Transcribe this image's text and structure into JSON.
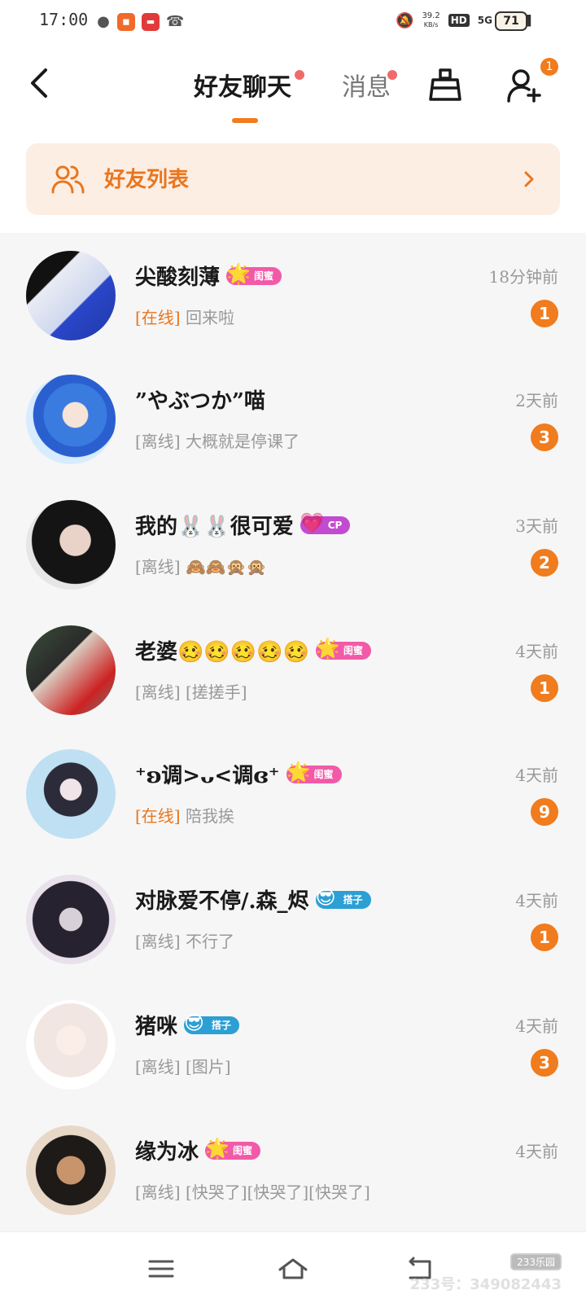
{
  "status_bar": {
    "time": "17:00",
    "net_speed_value": "39.2",
    "net_speed_unit": "KB/s",
    "hd": "HD",
    "network": "5G",
    "battery": "71"
  },
  "header": {
    "tab_friends_chat": "好友聊天",
    "tab_messages": "消息",
    "add_friend_badge": "1"
  },
  "friend_list_entry": {
    "label": "好友列表"
  },
  "chats": [
    {
      "name": "尖酸刻薄",
      "tag": "闺蜜",
      "tag_color": "#f25aa8",
      "time": "18分钟前",
      "status": "[在线]",
      "online": true,
      "preview": "回来啦",
      "unread": "1"
    },
    {
      "name": "”やぶつか”喵",
      "tag": "",
      "tag_color": "",
      "time": "2天前",
      "status": "[离线]",
      "online": false,
      "preview": "大概就是停课了",
      "unread": "3"
    },
    {
      "name": "我的🐰🐰很可爱",
      "tag": "CP",
      "tag_color": "#c24ccf",
      "time": "3天前",
      "status": "[离线]",
      "online": false,
      "preview": "🙈🙈🙊🙊",
      "unread": "2"
    },
    {
      "name": "老婆🥴🥴🥴🥴🥴",
      "tag": "闺蜜",
      "tag_color": "#f25aa8",
      "time": "4天前",
      "status": "[离线]",
      "online": false,
      "preview": "[搓搓手]",
      "unread": "1"
    },
    {
      "name": "⁺ʚ调>ᴗ<调ɞ⁺",
      "tag": "闺蜜",
      "tag_color": "#f25aa8",
      "time": "4天前",
      "status": "[在线]",
      "online": true,
      "preview": "陪我挨",
      "unread": "9"
    },
    {
      "name": "对脉爱不停/.森_烬",
      "tag": "搭子",
      "tag_color": "#2c9fd4",
      "time": "4天前",
      "status": "[离线]",
      "online": false,
      "preview": "不行了",
      "unread": "1"
    },
    {
      "name": "猪咪",
      "tag": "搭子",
      "tag_color": "#2c9fd4",
      "time": "4天前",
      "status": "[离线]",
      "online": false,
      "preview": "[图片]",
      "unread": "3"
    },
    {
      "name": "缘为冰",
      "tag": "闺蜜",
      "tag_color": "#f25aa8",
      "time": "4天前",
      "status": "[离线]",
      "online": false,
      "preview": "[快哭了][快哭了][快哭了]",
      "unread": ""
    }
  ],
  "watermark": {
    "logo": "233乐园",
    "text": "233号：349082443"
  }
}
